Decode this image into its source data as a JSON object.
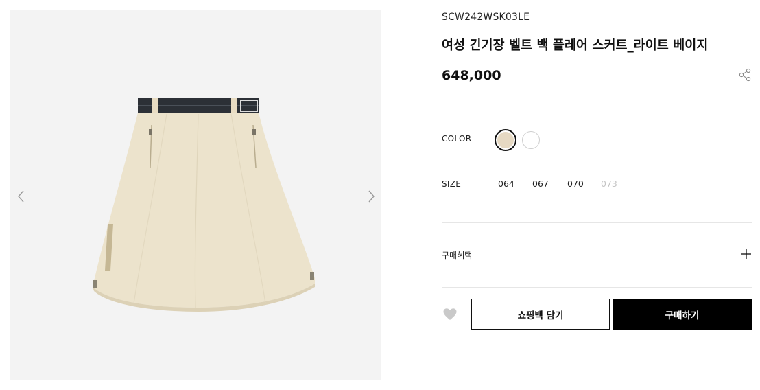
{
  "product": {
    "sku": "SCW242WSK03LE",
    "title": "여성 긴기장 벨트 백 플레어 스커트_라이트 베이지",
    "price": "648,000",
    "image_icon": "skirt-image"
  },
  "options": {
    "color_label": "COLOR",
    "colors": [
      {
        "name": "light-beige",
        "hex": "#e6d9c3",
        "selected": true
      },
      {
        "name": "white",
        "hex": "#ffffff",
        "selected": false
      }
    ],
    "size_label": "SIZE",
    "sizes": [
      {
        "label": "064",
        "available": true
      },
      {
        "label": "067",
        "available": true
      },
      {
        "label": "070",
        "available": true
      },
      {
        "label": "073",
        "available": false
      }
    ]
  },
  "benefits": {
    "label": "구매혜택"
  },
  "actions": {
    "cart_label": "쇼핑백 담기",
    "buy_label": "구매하기"
  },
  "icons": {
    "share": "share-icon",
    "plus": "plus-icon",
    "wishlist": "heart-icon",
    "prev": "chevron-left-icon",
    "next": "chevron-right-icon"
  },
  "colors": {
    "gallery_bg": "#f3f3f3",
    "skirt": "#ece3cc",
    "belt": "#2c3036",
    "primary_button": "#000000"
  }
}
